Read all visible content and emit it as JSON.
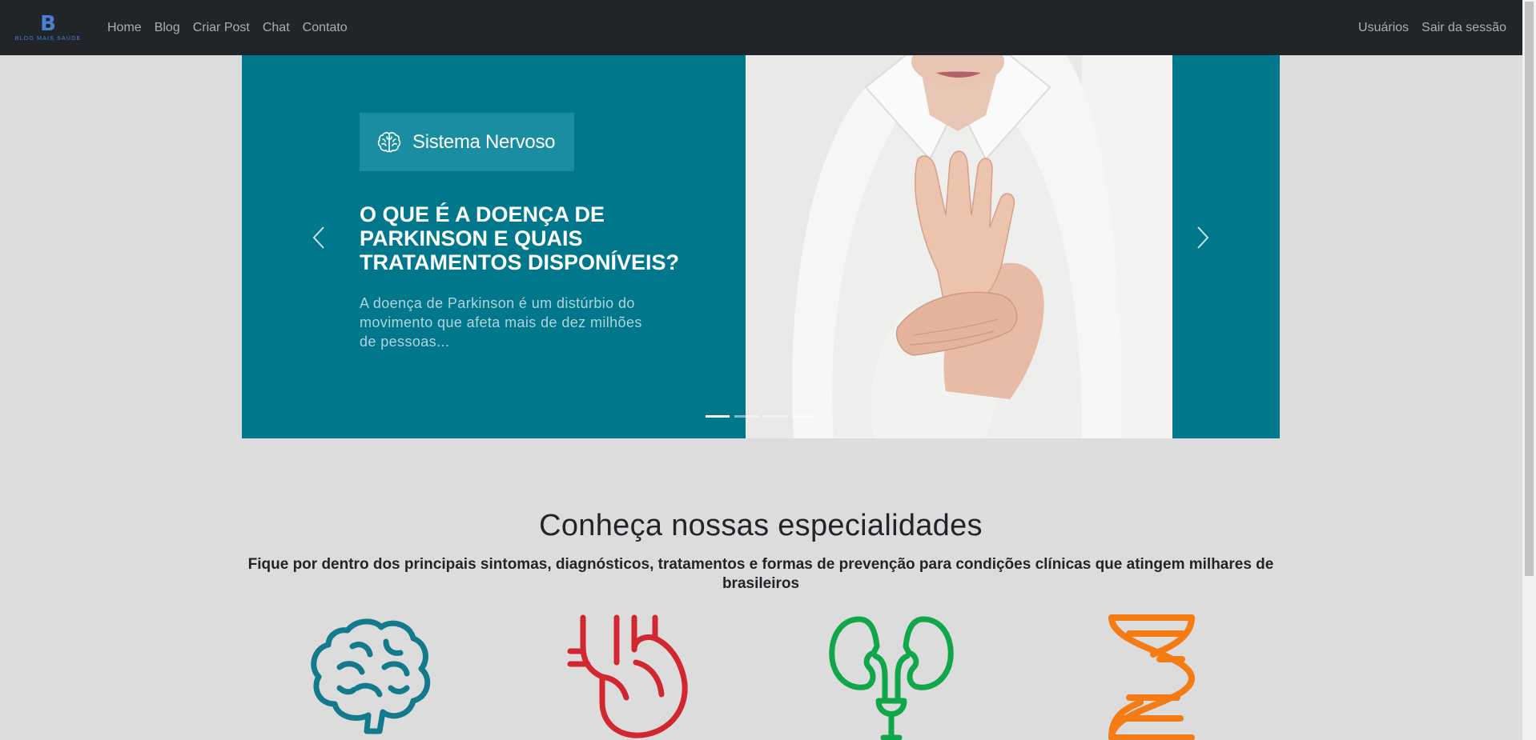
{
  "navbar": {
    "brand_letter": "B",
    "brand_text": "BLOG MAIS SAÚDE",
    "links": [
      "Home",
      "Blog",
      "Criar Post",
      "Chat",
      "Contato"
    ],
    "right_links": [
      "Usuários",
      "Sair da sessão"
    ]
  },
  "carousel": {
    "category": "Sistema Nervoso",
    "category_icon": "brain-icon",
    "title": "O que é a doença de Parkinson e quais tratamentos disponíveis?",
    "excerpt": "A doença de Parkinson é um distúrbio do movimento que afeta mais de dez milhões de pessoas...",
    "slide_count": 4,
    "active_slide": 1,
    "background_color": "#00778b",
    "badge_color": "#1a8ea0"
  },
  "specialties": {
    "title": "Conheça nossas especialidades",
    "subtitle": "Fique por dentro dos principais sintomas, diagnósticos, tratamentos e formas de prevenção para condições clínicas que atingem milhares de brasileiros",
    "items": [
      {
        "icon": "brain-icon",
        "color": "#137a8c"
      },
      {
        "icon": "heart-icon",
        "color": "#d0282e"
      },
      {
        "icon": "kidneys-icon",
        "color": "#12a64b"
      },
      {
        "icon": "dna-icon",
        "color": "#f57c14"
      }
    ]
  }
}
